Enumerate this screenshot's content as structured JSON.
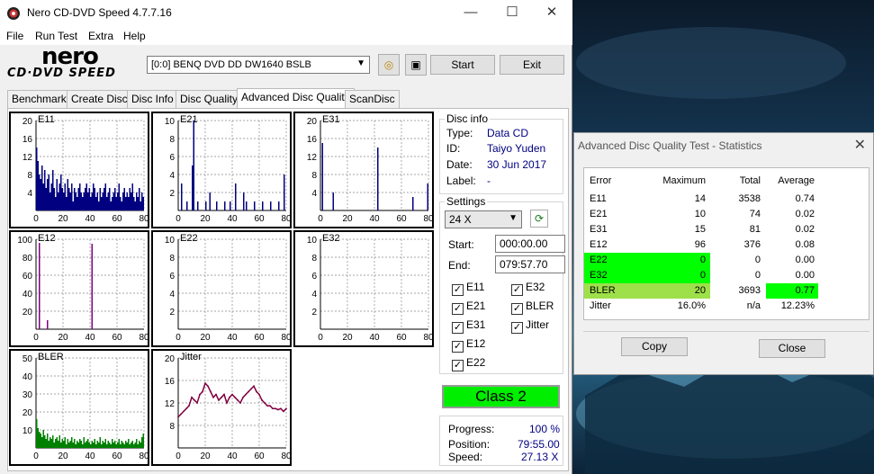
{
  "app": {
    "title": "Nero CD-DVD Speed 4.7.7.16",
    "logo_top": "nero",
    "logo_bottom": "CD·DVD SPEED",
    "controls": {
      "minimize": "—",
      "maximize": "☐",
      "close": "✕"
    }
  },
  "menu": [
    "File",
    "Run Test",
    "Extra",
    "Help"
  ],
  "toolbar": {
    "drive": "[0:0]   BENQ DVD DD DW1640 BSLB",
    "start": "Start",
    "exit": "Exit"
  },
  "tabs": [
    "Benchmark",
    "Create Disc",
    "Disc Info",
    "Disc Quality",
    "Advanced Disc Quality",
    "ScanDisc"
  ],
  "active_tab": "Advanced Disc Quality",
  "disc_info": {
    "heading": "Disc info",
    "type_label": "Type:",
    "type": "Data CD",
    "id_label": "ID:",
    "id": "Taiyo Yuden",
    "date_label": "Date:",
    "date": "30 Jun 2017",
    "label_label": "Label:",
    "label": "-"
  },
  "settings": {
    "heading": "Settings",
    "speed": "24 X",
    "start_label": "Start:",
    "start": "000:00.00",
    "end_label": "End:",
    "end": "079:57.70",
    "checks": [
      {
        "label": "E11",
        "checked": true
      },
      {
        "label": "E32",
        "checked": true
      },
      {
        "label": "E21",
        "checked": true
      },
      {
        "label": "BLER",
        "checked": true
      },
      {
        "label": "E31",
        "checked": true
      },
      {
        "label": "Jitter",
        "checked": true
      },
      {
        "label": "E12",
        "checked": true
      },
      {
        "label": "E22",
        "checked": true
      }
    ]
  },
  "class": "Class 2",
  "progress": {
    "progress_label": "Progress:",
    "progress": "100 %",
    "position_label": "Position:",
    "position": "79:55.00",
    "speed_label": "Speed:",
    "speed": "27.13 X"
  },
  "stats_dialog": {
    "title": "Advanced Disc Quality Test - Statistics",
    "headers": [
      "Error",
      "Maximum",
      "Total",
      "Average"
    ],
    "rows": [
      {
        "error": "E11",
        "maximum": "14",
        "total": "3538",
        "average": "0.74"
      },
      {
        "error": "E21",
        "maximum": "10",
        "total": "74",
        "average": "0.02"
      },
      {
        "error": "E31",
        "maximum": "15",
        "total": "81",
        "average": "0.02"
      },
      {
        "error": "E12",
        "maximum": "96",
        "total": "376",
        "average": "0.08"
      },
      {
        "error": "E22",
        "maximum": "0",
        "total": "0",
        "average": "0.00"
      },
      {
        "error": "E32",
        "maximum": "0",
        "total": "0",
        "average": "0.00"
      },
      {
        "error": "BLER",
        "maximum": "20",
        "total": "3693",
        "average": "0.77"
      },
      {
        "error": "Jitter",
        "maximum": "16.0%",
        "total": "n/a",
        "average": "12.23%"
      }
    ],
    "copy": "Copy",
    "close": "Close",
    "highlight_color": "#00ff00"
  },
  "chart_data": [
    {
      "type": "bar",
      "title": "E11",
      "x_ticks": [
        0,
        20,
        40,
        60,
        80
      ],
      "y_ticks": [
        4,
        8,
        12,
        16,
        20
      ],
      "ylim": [
        0,
        20
      ],
      "xlim": [
        0,
        80
      ],
      "color": "#000080",
      "values": [
        14,
        11,
        8,
        7,
        10,
        6,
        9,
        5,
        7,
        8,
        4,
        6,
        9,
        5,
        3,
        7,
        4,
        6,
        8,
        5,
        4,
        6,
        3,
        7,
        5,
        4,
        6,
        2,
        5,
        4,
        3,
        5,
        6,
        4,
        3,
        4,
        5,
        6,
        4,
        5,
        3,
        4,
        6,
        5,
        3,
        4,
        2,
        5,
        3,
        4,
        5,
        6,
        3,
        4,
        5,
        2,
        3,
        4,
        5,
        3,
        4,
        6,
        3,
        2,
        4,
        5,
        3,
        4,
        3,
        5,
        4,
        6,
        3,
        2,
        4,
        3,
        5,
        2,
        4,
        3
      ]
    },
    {
      "type": "bar",
      "title": "E21",
      "x_ticks": [
        0,
        20,
        40,
        60,
        80
      ],
      "y_ticks": [
        2,
        4,
        6,
        8,
        10
      ],
      "ylim": [
        0,
        10
      ],
      "xlim": [
        0,
        80
      ],
      "color": "#000080",
      "spikes": [
        [
          2,
          3
        ],
        [
          6,
          1
        ],
        [
          10,
          5
        ],
        [
          11,
          10
        ],
        [
          14,
          1
        ],
        [
          20,
          1
        ],
        [
          23,
          2
        ],
        [
          28,
          1
        ],
        [
          34,
          1
        ],
        [
          38,
          1
        ],
        [
          42,
          3
        ],
        [
          48,
          2
        ],
        [
          50,
          1
        ],
        [
          56,
          1
        ],
        [
          62,
          1
        ],
        [
          68,
          1
        ],
        [
          74,
          1
        ],
        [
          78,
          4
        ]
      ]
    },
    {
      "type": "bar",
      "title": "E31",
      "x_ticks": [
        0,
        20,
        40,
        60,
        80
      ],
      "y_ticks": [
        4,
        8,
        12,
        16,
        20
      ],
      "ylim": [
        0,
        20
      ],
      "xlim": [
        0,
        80
      ],
      "color": "#000080",
      "spikes": [
        [
          1,
          15
        ],
        [
          9,
          4
        ],
        [
          42,
          14
        ],
        [
          68,
          3
        ],
        [
          79,
          6
        ]
      ]
    },
    {
      "type": "bar",
      "title": "E12",
      "x_ticks": [
        0,
        20,
        40,
        60,
        80
      ],
      "y_ticks": [
        20,
        40,
        60,
        80,
        100
      ],
      "ylim": [
        0,
        100
      ],
      "xlim": [
        0,
        80
      ],
      "color": "#800080",
      "spikes": [
        [
          2,
          96
        ],
        [
          8,
          10
        ],
        [
          41,
          95
        ]
      ]
    },
    {
      "type": "bar",
      "title": "E22",
      "x_ticks": [
        0,
        20,
        40,
        60,
        80
      ],
      "y_ticks": [
        2,
        4,
        6,
        8,
        10
      ],
      "ylim": [
        0,
        10
      ],
      "xlim": [
        0,
        80
      ],
      "color": "#800080",
      "spikes": []
    },
    {
      "type": "bar",
      "title": "E32",
      "x_ticks": [
        0,
        20,
        40,
        60,
        80
      ],
      "y_ticks": [
        2,
        4,
        6,
        8,
        10
      ],
      "ylim": [
        0,
        10
      ],
      "xlim": [
        0,
        80
      ],
      "color": "#800080",
      "spikes": []
    },
    {
      "type": "bar",
      "title": "BLER",
      "x_ticks": [
        0,
        20,
        40,
        60,
        80
      ],
      "y_ticks": [
        10,
        20,
        30,
        40,
        50
      ],
      "ylim": [
        0,
        50
      ],
      "xlim": [
        0,
        80
      ],
      "color": "#008000",
      "values": [
        16,
        11,
        9,
        8,
        6,
        10,
        7,
        5,
        8,
        4,
        6,
        5,
        7,
        3,
        5,
        6,
        4,
        7,
        3,
        5,
        4,
        6,
        2,
        5,
        3,
        4,
        6,
        3,
        5,
        2,
        4,
        3,
        5,
        4,
        2,
        6,
        3,
        4,
        5,
        3,
        2,
        4,
        3,
        5,
        2,
        4,
        3,
        6,
        2,
        4,
        3,
        5,
        2,
        4,
        3,
        2,
        5,
        3,
        4,
        2,
        3,
        5,
        2,
        4,
        3,
        2,
        4,
        3,
        5,
        2,
        3,
        4,
        2,
        3,
        5,
        2,
        4,
        3,
        6,
        8
      ]
    },
    {
      "type": "line",
      "title": "Jitter",
      "x_ticks": [
        0,
        20,
        40,
        60,
        80
      ],
      "y_ticks": [
        8,
        12,
        16,
        20
      ],
      "ylim": [
        4,
        20
      ],
      "xlim": [
        0,
        80
      ],
      "color": "#800040",
      "x": [
        0,
        2,
        4,
        6,
        8,
        10,
        12,
        14,
        16,
        18,
        20,
        22,
        24,
        26,
        28,
        30,
        32,
        34,
        36,
        38,
        40,
        42,
        44,
        46,
        48,
        50,
        52,
        54,
        56,
        58,
        60,
        62,
        64,
        66,
        68,
        70,
        72,
        74,
        76,
        78,
        80
      ],
      "y": [
        9.5,
        10,
        10.5,
        11,
        11.5,
        13,
        12.5,
        12,
        13.5,
        14,
        15.5,
        15,
        14,
        13,
        13.5,
        12.5,
        13,
        13.5,
        12,
        13,
        13.5,
        13,
        12.5,
        12,
        13,
        13.5,
        14,
        14.5,
        15,
        14,
        13.5,
        12.5,
        12,
        11.5,
        11.5,
        11,
        11,
        10.8,
        11,
        10.5,
        11
      ]
    }
  ]
}
